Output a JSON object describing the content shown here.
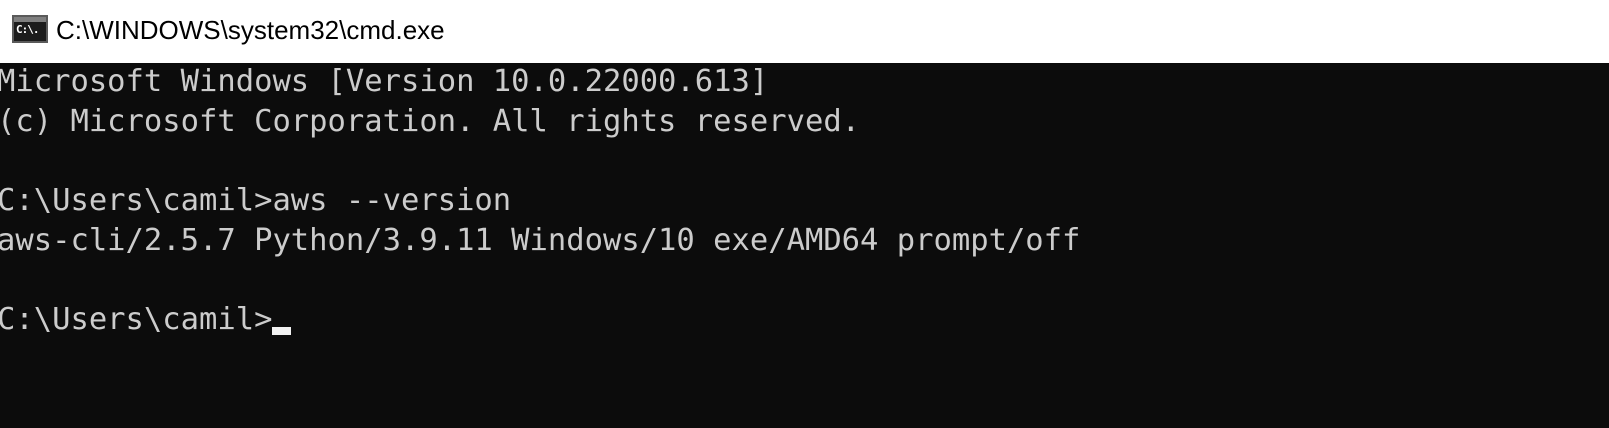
{
  "window": {
    "title": "C:\\WINDOWS\\system32\\cmd.exe",
    "icon": "cmd-icon",
    "icon_text": "C:\\."
  },
  "console": {
    "background": "#0c0c0c",
    "foreground": "#cccccc",
    "lines": [
      "Microsoft Windows [Version 10.0.22000.613]",
      "(c) Microsoft Corporation. All rights reserved.",
      "",
      "C:\\Users\\camil>aws --version",
      "aws-cli/2.5.7 Python/3.9.11 Windows/10 exe/AMD64 prompt/off",
      "",
      "C:\\Users\\camil>"
    ]
  }
}
